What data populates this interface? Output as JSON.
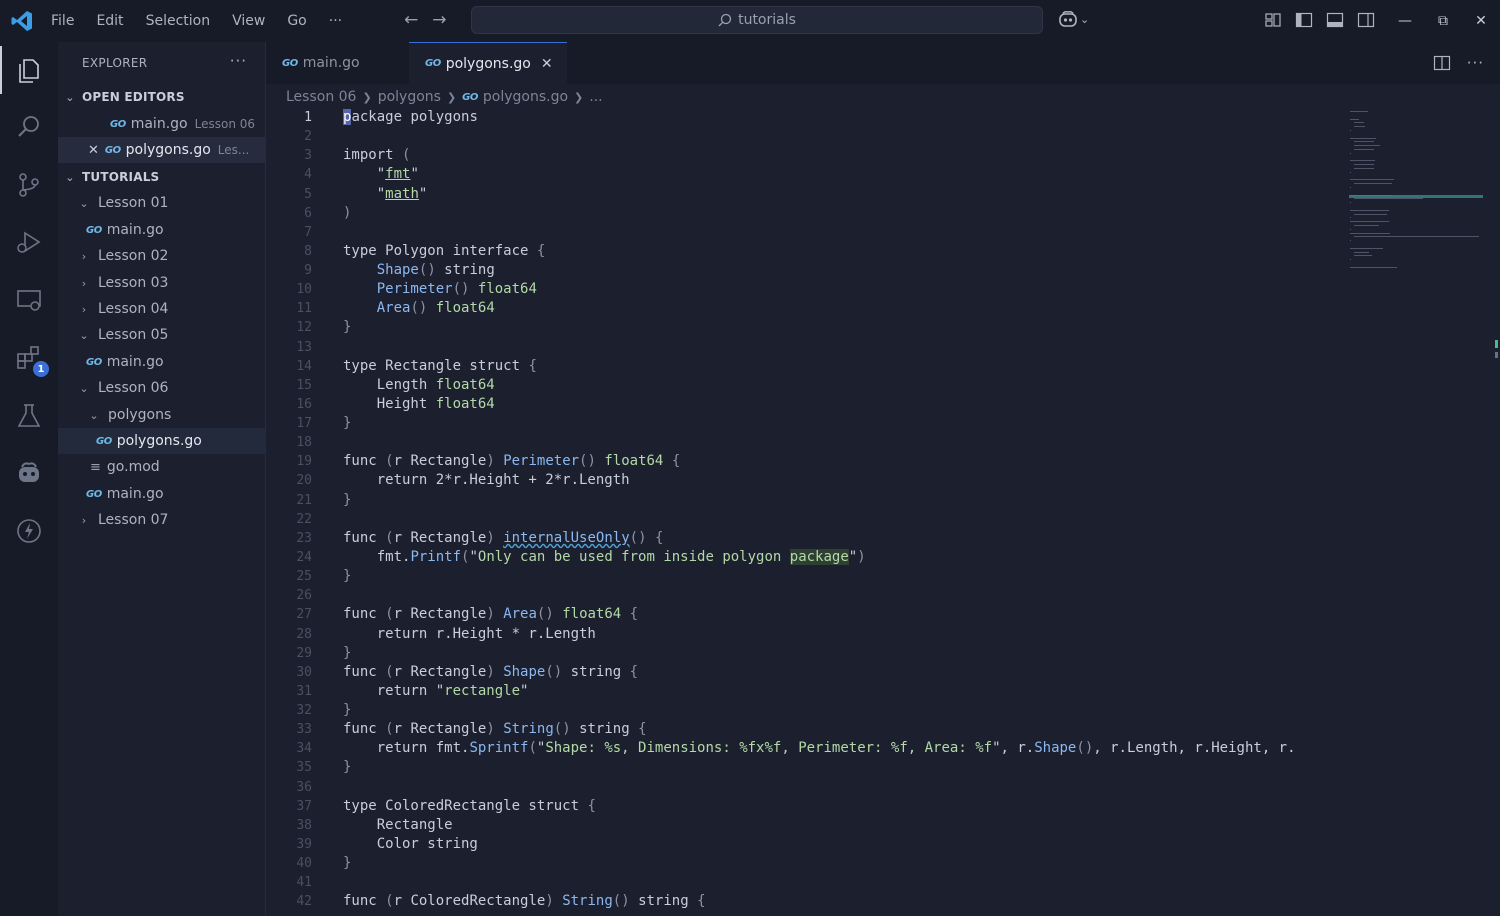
{
  "menu": [
    "File",
    "Edit",
    "Selection",
    "View",
    "Go",
    "···"
  ],
  "search": {
    "text": "tutorials"
  },
  "sidebar": {
    "title": "EXPLORER",
    "open_editors_label": "OPEN EDITORS",
    "open_editors": [
      {
        "name": "main.go",
        "desc": "Lesson 06"
      },
      {
        "name": "polygons.go",
        "desc": "Les..."
      }
    ],
    "workspace_label": "TUTORIALS",
    "tree": [
      {
        "label": "Lesson 01",
        "kind": "folder-open"
      },
      {
        "label": "main.go",
        "kind": "go"
      },
      {
        "label": "Lesson 02",
        "kind": "folder"
      },
      {
        "label": "Lesson 03",
        "kind": "folder"
      },
      {
        "label": "Lesson 04",
        "kind": "folder"
      },
      {
        "label": "Lesson 05",
        "kind": "folder-open"
      },
      {
        "label": "main.go",
        "kind": "go"
      },
      {
        "label": "Lesson 06",
        "kind": "folder-open"
      },
      {
        "label": "polygons",
        "kind": "folder-open"
      },
      {
        "label": "polygons.go",
        "kind": "go"
      },
      {
        "label": "go.mod",
        "kind": "mod"
      },
      {
        "label": "main.go",
        "kind": "go"
      },
      {
        "label": "Lesson 07",
        "kind": "folder"
      }
    ]
  },
  "tabs": [
    {
      "label": "main.go",
      "active": false
    },
    {
      "label": "polygons.go",
      "active": true
    }
  ],
  "breadcrumb": [
    "Lesson 06",
    "polygons",
    "polygons.go",
    "..."
  ],
  "extensions_badge": "1",
  "icons": {
    "activity": [
      "explorer-icon",
      "search-icon",
      "source-control-icon",
      "run-debug-icon",
      "remote-explorer-icon",
      "extensions-icon",
      "testing-icon",
      "copilot-icon",
      "lightning-icon"
    ]
  },
  "colors": {
    "accent": "#3a6fd8",
    "string": "#b3d9a6",
    "function": "#8bb8f0",
    "background": "#1b1f2e"
  },
  "code": [
    "package polygons",
    "",
    "import (",
    "    \"fmt\"",
    "    \"math\"",
    ")",
    "",
    "type Polygon interface {",
    "    Shape() string",
    "    Perimeter() float64",
    "    Area() float64",
    "}",
    "",
    "type Rectangle struct {",
    "    Length float64",
    "    Height float64",
    "}",
    "",
    "func (r Rectangle) Perimeter() float64 {",
    "    return 2*r.Height + 2*r.Length",
    "}",
    "",
    "func (r Rectangle) internalUseOnly() {",
    "    fmt.Printf(\"Only can be used from inside polygon package\")",
    "}",
    "",
    "func (r Rectangle) Area() float64 {",
    "    return r.Height * r.Length",
    "}",
    "func (r Rectangle) Shape() string {",
    "    return \"rectangle\"",
    "}",
    "func (r Rectangle) String() string {",
    "    return fmt.Sprintf(\"Shape: %s, Dimensions: %fx%f, Perimeter: %f, Area: %f\", r.Shape(), r.Length, r.Height, r.",
    "}",
    "",
    "type ColoredRectangle struct {",
    "    Rectangle",
    "    Color string",
    "}",
    "",
    "func (r ColoredRectangle) String() string {"
  ]
}
